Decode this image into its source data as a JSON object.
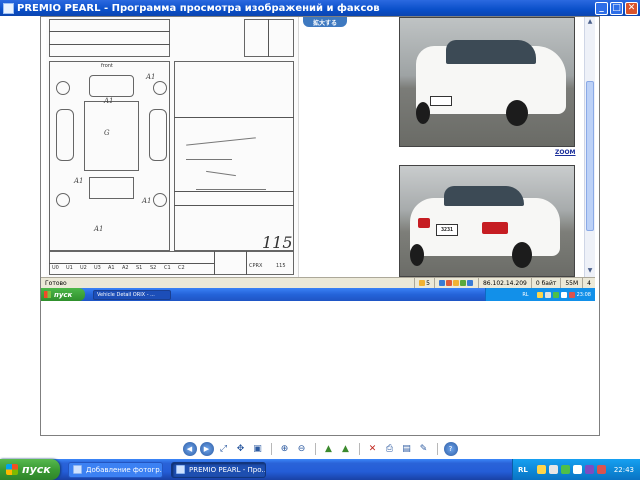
{
  "window": {
    "title": "PREMIO PEARL - Программа просмотра изображений и факсов",
    "buttons": [
      "minimize",
      "maximize",
      "close"
    ]
  },
  "inner_page": {
    "zoom_button": "拡大する",
    "zoom_link": "ZOOM",
    "plate_front": "",
    "plate_rear": "3231",
    "sheet": {
      "score": "115",
      "label_front": "front",
      "grades": [
        "A1",
        "A1",
        "A1",
        "A1",
        "A1",
        "G"
      ],
      "col_labels": [
        "U0",
        "U1",
        "U2",
        "U3",
        "A1",
        "A2",
        "S1",
        "S2",
        "C1",
        "C2"
      ],
      "code_label": "CPRX",
      "code_value": "115"
    },
    "status": {
      "text": "Готово",
      "page": "5",
      "ip": "86.102.14.209",
      "bytes": "0 байт",
      "size": "55M",
      "count": "4"
    },
    "taskbar": {
      "start": "пуск",
      "task": "Vehicle Detail ORIX - ...",
      "lang": "RL",
      "time": "23:08"
    }
  },
  "viewer_toolbar": {
    "icons": [
      "previous-icon",
      "next-icon",
      "best-fit-icon",
      "actual-size-icon",
      "zoom-in-icon",
      "zoom-out-icon",
      "rotate-clockwise-icon",
      "rotate-counterclockwise-icon",
      "delete-icon",
      "print-icon",
      "save-icon",
      "edit-icon",
      "help-icon"
    ]
  },
  "taskbar": {
    "start_label": "пуск",
    "tasks": [
      {
        "label": "Добавление фотогр...",
        "active": false
      },
      {
        "label": "PREMIO PEARL - Про...",
        "active": true
      }
    ],
    "lang": "RL",
    "time": "22:43"
  },
  "colors": {
    "title_bar": "#0a4fc9",
    "taskbar": "#245dd7",
    "start_button": "#3a9b34",
    "tray": "#0e8ad9",
    "zoom_button": "#3e79c0"
  }
}
